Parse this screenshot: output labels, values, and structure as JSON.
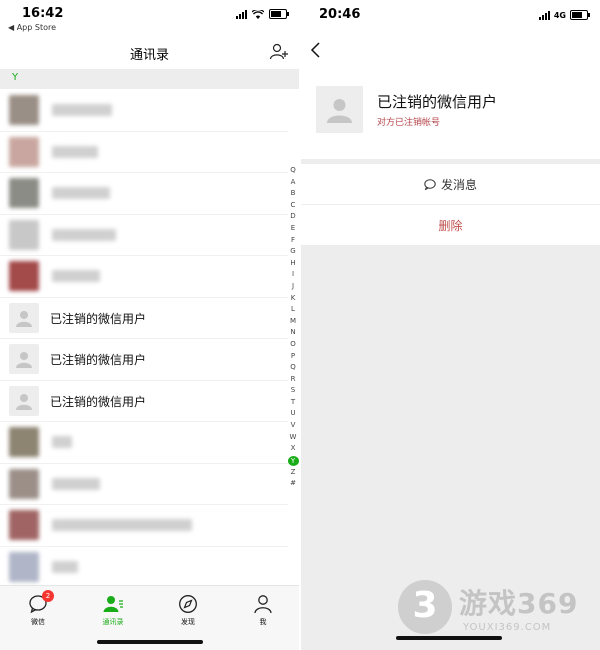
{
  "left": {
    "status": {
      "time": "16:42",
      "back_app": "◀ App Store"
    },
    "title": "通讯录",
    "section_letter": "Y",
    "contacts": [
      {
        "kind": "blurred",
        "avatar_color": "#9a8f86",
        "name_width": 60
      },
      {
        "kind": "blurred",
        "avatar_color": "#c9a7a0",
        "name_width": 46
      },
      {
        "kind": "blurred",
        "avatar_color": "#8c8c86",
        "name_width": 58
      },
      {
        "kind": "blurred",
        "avatar_color": "#c8c8c8",
        "name_width": 64
      },
      {
        "kind": "blurred",
        "avatar_color": "#a34a4a",
        "name_width": 48
      },
      {
        "kind": "deleted",
        "name": "已注销的微信用户"
      },
      {
        "kind": "deleted",
        "name": "已注销的微信用户"
      },
      {
        "kind": "deleted",
        "name": "已注销的微信用户"
      },
      {
        "kind": "blurred",
        "avatar_color": "#8d8472",
        "name_width": 20
      },
      {
        "kind": "blurred",
        "avatar_color": "#9c8f88",
        "name_width": 48
      },
      {
        "kind": "blurred",
        "avatar_color": "#a06464",
        "name_width": 140
      },
      {
        "kind": "blurred",
        "avatar_color": "#b0b6c8",
        "name_width": 26
      }
    ],
    "index_letters": [
      "Q",
      "A",
      "B",
      "C",
      "D",
      "E",
      "F",
      "G",
      "H",
      "I",
      "J",
      "K",
      "L",
      "M",
      "N",
      "O",
      "P",
      "Q",
      "R",
      "S",
      "T",
      "U",
      "V",
      "W",
      "X",
      "Y",
      "Z",
      "#"
    ],
    "index_active": "Y",
    "tabs": [
      {
        "label": "微信",
        "badge": "2",
        "active": false,
        "icon": "chat-bubble-icon"
      },
      {
        "label": "通讯录",
        "badge": "",
        "active": true,
        "icon": "contacts-icon"
      },
      {
        "label": "发现",
        "badge": "",
        "active": false,
        "icon": "compass-icon"
      },
      {
        "label": "我",
        "badge": "",
        "active": false,
        "icon": "person-icon"
      }
    ]
  },
  "right": {
    "status": {
      "time": "20:46",
      "network": "4G"
    },
    "profile_name": "已注销的微信用户",
    "profile_sub": "对方已注销帐号",
    "send_message": "发消息",
    "delete": "删除"
  },
  "watermark": {
    "logo": "3",
    "text": "游戏369",
    "url": "YOUXI369.COM"
  },
  "colors": {
    "accent": "#1aad19",
    "danger": "#c0504d",
    "badge": "#f43530",
    "subtext": "#b5454b"
  }
}
